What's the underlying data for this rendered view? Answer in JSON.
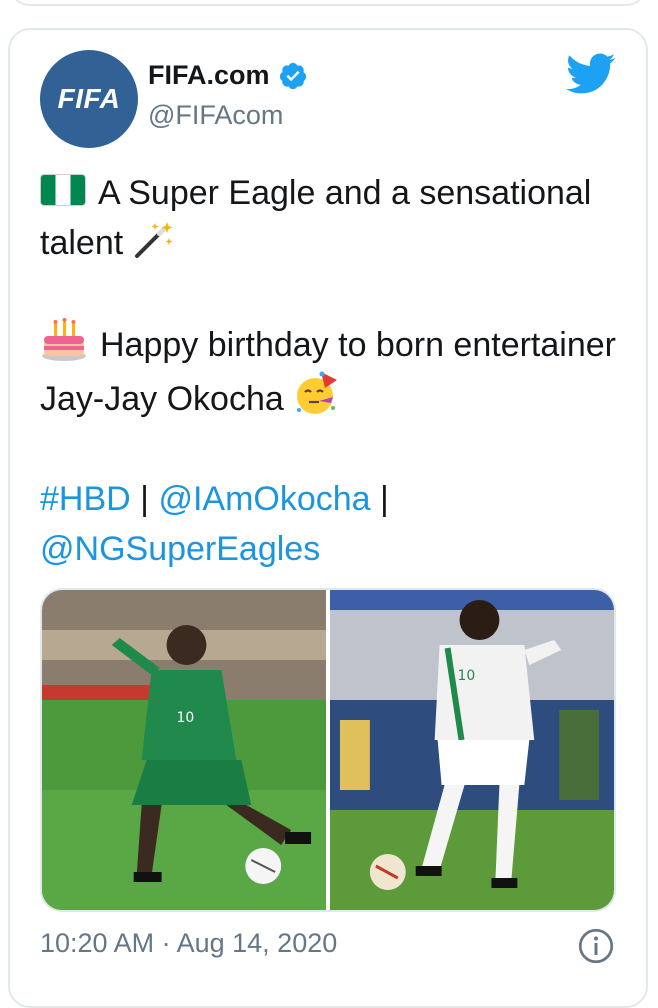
{
  "author": {
    "avatar_text": "FIFA",
    "display_name": "FIFA.com",
    "handle": "@FIFAcom"
  },
  "tweet": {
    "line1": "A Super Eagle and a sensational talent",
    "line2": "Happy birthday to born entertainer Jay-Jay Okocha",
    "hashtag": "#HBD",
    "separator1": " | ",
    "mention1": "@IAmOkocha",
    "separator2": " |",
    "mention2": "@NGSuperEagles"
  },
  "meta": {
    "time": "10:20 AM",
    "dot": " · ",
    "date": "Aug 14, 2020"
  },
  "media": {
    "photo1_number": "10",
    "photo2_number": "10"
  },
  "icons": [
    "verified-badge-icon",
    "twitter-bird-icon",
    "nigeria-flag-icon",
    "magic-wand-icon",
    "birthday-cake-icon",
    "party-face-icon",
    "info-icon"
  ],
  "colors": {
    "link": "#1b95e0",
    "avatar_bg": "#326295",
    "secondary_text": "#657786",
    "twitter_blue": "#1da1f2"
  }
}
